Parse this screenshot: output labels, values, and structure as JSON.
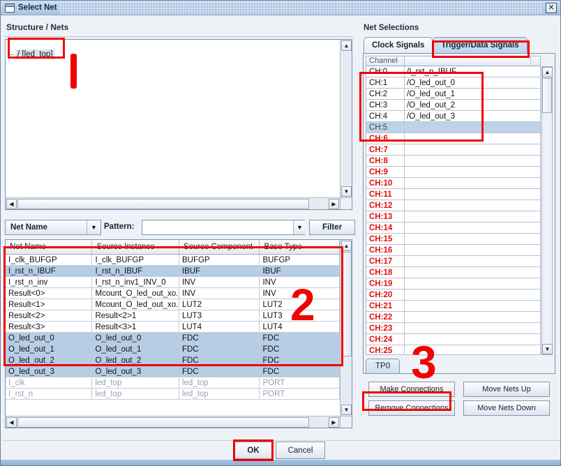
{
  "window": {
    "title": "Select Net",
    "close_label": "✕",
    "icon": "window-icon"
  },
  "left": {
    "panel_title": "Structure / Nets",
    "tree_root": "/ [led_top]",
    "filter": {
      "scope_value": "Net Name",
      "pattern_label": "Pattern:",
      "pattern_value": "",
      "filter_button": "Filter",
      "dropdown_arrow": "▼"
    },
    "table": {
      "columns": [
        "Net Name",
        "Source Instance",
        "Source Component",
        "Base Type"
      ],
      "rows": [
        {
          "cells": [
            "I_clk_BUFGP",
            "I_clk_BUFGP",
            "BUFGP",
            "BUFGP"
          ],
          "state": "normal"
        },
        {
          "cells": [
            "I_rst_n_IBUF",
            "I_rst_n_IBUF",
            "IBUF",
            "IBUF"
          ],
          "state": "selected"
        },
        {
          "cells": [
            "I_rst_n_inv",
            "I_rst_n_inv1_INV_0",
            "INV",
            "INV"
          ],
          "state": "normal"
        },
        {
          "cells": [
            "Result<0>",
            "Mcount_O_led_out_xo...",
            "INV",
            "INV"
          ],
          "state": "normal"
        },
        {
          "cells": [
            "Result<1>",
            "Mcount_O_led_out_xo...",
            "LUT2",
            "LUT2"
          ],
          "state": "normal"
        },
        {
          "cells": [
            "Result<2>",
            "Result<2>1",
            "LUT3",
            "LUT3"
          ],
          "state": "normal"
        },
        {
          "cells": [
            "Result<3>",
            "Result<3>1",
            "LUT4",
            "LUT4"
          ],
          "state": "normal"
        },
        {
          "cells": [
            "O_led_out_0",
            "O_led_out_0",
            "FDC",
            "FDC"
          ],
          "state": "selected"
        },
        {
          "cells": [
            "O_led_out_1",
            "O_led_out_1",
            "FDC",
            "FDC"
          ],
          "state": "selected"
        },
        {
          "cells": [
            "O_led_out_2",
            "O_led_out_2",
            "FDC",
            "FDC"
          ],
          "state": "selected"
        },
        {
          "cells": [
            "O_led_out_3",
            "O_led_out_3",
            "FDC",
            "FDC"
          ],
          "state": "selected"
        },
        {
          "cells": [
            "I_clk",
            "led_top",
            "led_top",
            "PORT"
          ],
          "state": "dim"
        },
        {
          "cells": [
            "I_rst_n",
            "led_top",
            "led_top",
            "PORT"
          ],
          "state": "dim"
        }
      ]
    }
  },
  "right": {
    "panel_title": "Net Selections",
    "tabs": [
      {
        "label": "Clock Signals",
        "active": false
      },
      {
        "label": "Trigger/Data Signals",
        "active": true
      }
    ],
    "channel_header": [
      "Channel",
      ""
    ],
    "channels": [
      {
        "ch": "CH:0",
        "net": "/I_rst_n_IBUF",
        "style": "assigned"
      },
      {
        "ch": "CH:1",
        "net": "/O_led_out_0",
        "style": "assigned"
      },
      {
        "ch": "CH:2",
        "net": "/O_led_out_1",
        "style": "assigned"
      },
      {
        "ch": "CH:3",
        "net": "/O_led_out_2",
        "style": "assigned"
      },
      {
        "ch": "CH:4",
        "net": "/O_led_out_3",
        "style": "assigned"
      },
      {
        "ch": "CH:5",
        "net": "",
        "style": "selected"
      },
      {
        "ch": "CH:6",
        "net": "",
        "style": "empty"
      },
      {
        "ch": "CH:7",
        "net": "",
        "style": "empty"
      },
      {
        "ch": "CH:8",
        "net": "",
        "style": "empty"
      },
      {
        "ch": "CH:9",
        "net": "",
        "style": "empty"
      },
      {
        "ch": "CH:10",
        "net": "",
        "style": "empty"
      },
      {
        "ch": "CH:11",
        "net": "",
        "style": "empty"
      },
      {
        "ch": "CH:12",
        "net": "",
        "style": "empty"
      },
      {
        "ch": "CH:13",
        "net": "",
        "style": "empty"
      },
      {
        "ch": "CH:14",
        "net": "",
        "style": "empty"
      },
      {
        "ch": "CH:15",
        "net": "",
        "style": "empty"
      },
      {
        "ch": "CH:16",
        "net": "",
        "style": "empty"
      },
      {
        "ch": "CH:17",
        "net": "",
        "style": "empty"
      },
      {
        "ch": "CH:18",
        "net": "",
        "style": "empty"
      },
      {
        "ch": "CH:19",
        "net": "",
        "style": "empty"
      },
      {
        "ch": "CH:20",
        "net": "",
        "style": "empty"
      },
      {
        "ch": "CH:21",
        "net": "",
        "style": "empty"
      },
      {
        "ch": "CH:22",
        "net": "",
        "style": "empty"
      },
      {
        "ch": "CH:23",
        "net": "",
        "style": "empty"
      },
      {
        "ch": "CH:24",
        "net": "",
        "style": "empty"
      },
      {
        "ch": "CH:25",
        "net": "",
        "style": "empty"
      }
    ],
    "unit_tab": "TP0",
    "buttons": {
      "make_connections": "Make Connections",
      "remove_connections": "Remove Connections",
      "move_nets_up": "Move Nets Up",
      "move_nets_down": "Move Nets Down"
    }
  },
  "footer": {
    "ok": "OK",
    "cancel": "Cancel"
  },
  "annotations": {
    "markers": [
      "1",
      "2",
      "3"
    ],
    "color": "#f00200"
  }
}
